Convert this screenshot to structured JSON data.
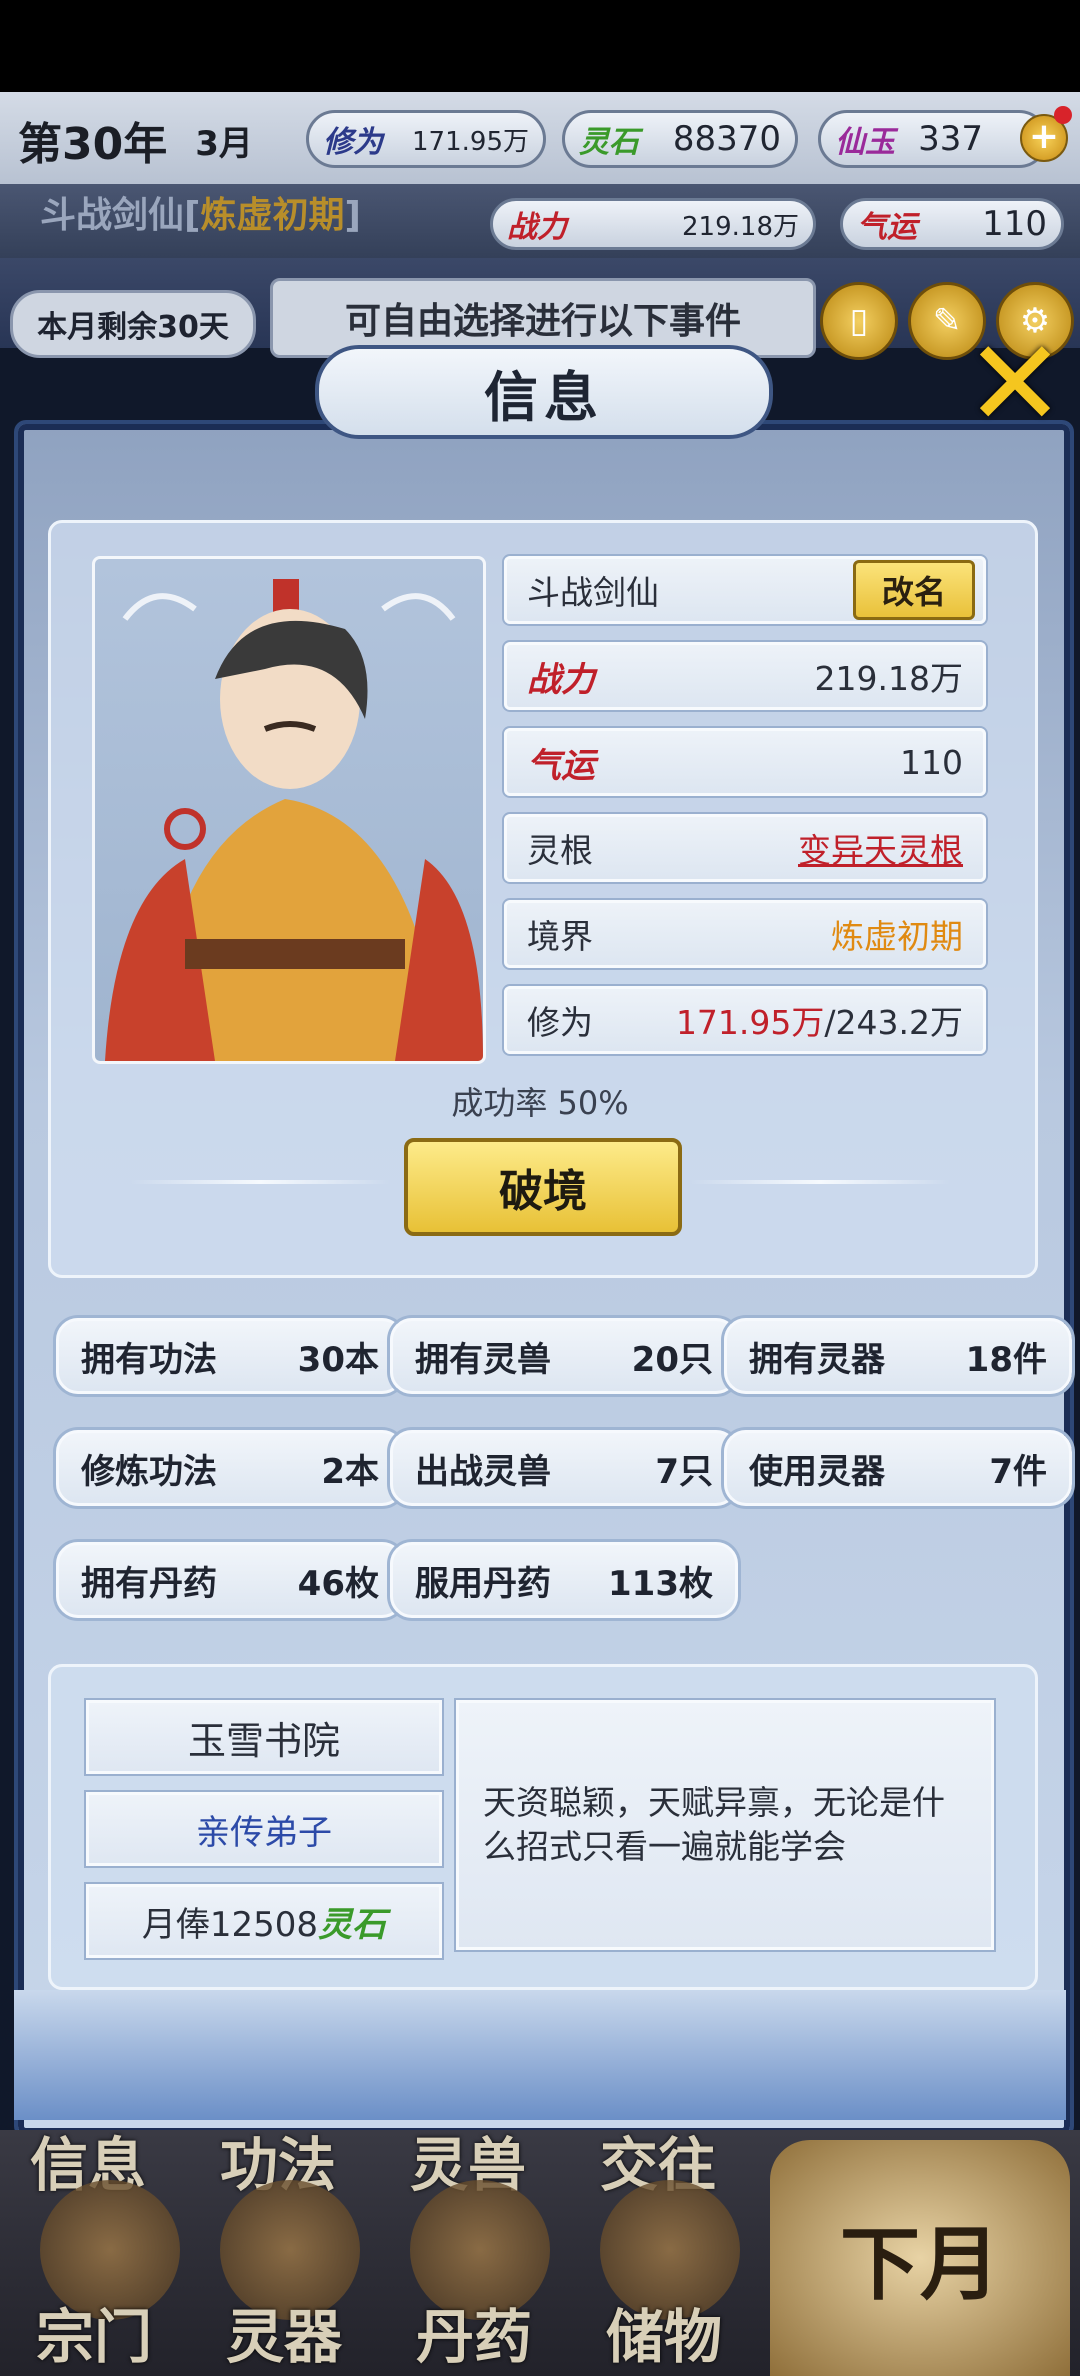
{
  "hud": {
    "year": "第30年",
    "month": "3月",
    "cultivation_label": "修为",
    "cultivation_value": "171.95万",
    "spirit_stone_label": "灵石",
    "spirit_stone_value": "88370",
    "jade_label": "仙玉",
    "jade_value": "337",
    "char_name": "斗战剑仙",
    "realm_bracket_open": "[",
    "realm": "炼虚初期",
    "realm_bracket_close": "]",
    "power_label": "战力",
    "power_value": "219.18万",
    "luck_label": "气运",
    "luck_value": "110",
    "days_left": "本月剩余30天",
    "event_hint": "可自由选择进行以下事件"
  },
  "dialog": {
    "title": "信息",
    "name": "斗战剑仙",
    "rename_label": "改名",
    "power_label": "战力",
    "power_value": "219.18万",
    "luck_label": "气运",
    "luck_value": "110",
    "root_label": "灵根",
    "root_value": "变异天灵根",
    "realm_label": "境界",
    "realm_value": "炼虚初期",
    "cult_label": "修为",
    "cult_current": "171.95万",
    "cult_max": "/243.2万",
    "success_rate": "成功率 50%",
    "break_label": "破境"
  },
  "stats": [
    {
      "label": "拥有功法",
      "value": "30本"
    },
    {
      "label": "拥有灵兽",
      "value": "20只"
    },
    {
      "label": "拥有灵器",
      "value": "18件"
    },
    {
      "label": "修炼功法",
      "value": "2本"
    },
    {
      "label": "出战灵兽",
      "value": "7只"
    },
    {
      "label": "使用灵器",
      "value": "7件"
    },
    {
      "label": "拥有丹药",
      "value": "46枚"
    },
    {
      "label": "服用丹药",
      "value": "113枚"
    }
  ],
  "sect": {
    "name": "玉雪书院",
    "rank": "亲传弟子",
    "salary_prefix": "月俸12508",
    "salary_unit": "灵石",
    "description": "天资聪颖，天赋异禀，无论是什么招式只看一遍就能学会"
  },
  "nav": {
    "top_labels": [
      "信息",
      "功法",
      "灵兽",
      "交往"
    ],
    "bottom_labels": [
      "宗门",
      "灵器",
      "丹药",
      "储物"
    ],
    "next_month": "下月"
  },
  "colors": {
    "accent_gold": "#f5c61f",
    "power_red": "#c0202a",
    "realm_orange": "#e08a12",
    "rank_blue": "#2c4aa8",
    "stone_green": "#3a9a2a"
  }
}
